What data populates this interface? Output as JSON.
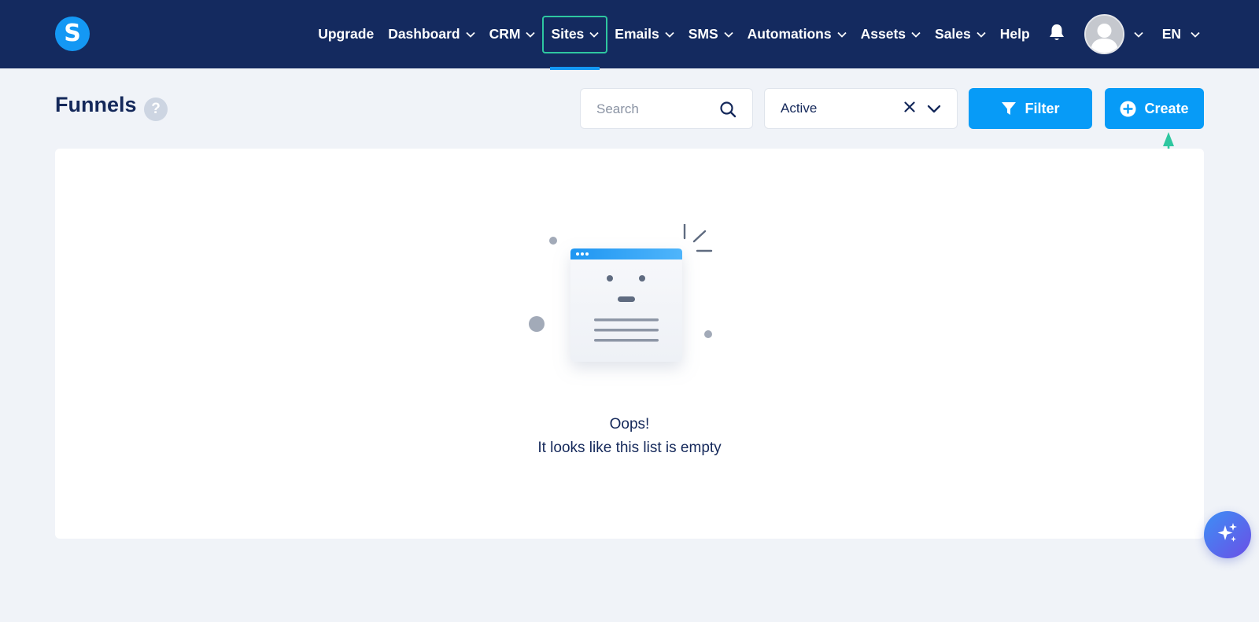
{
  "brand": {
    "logo_letter": "S"
  },
  "nav": {
    "items": [
      {
        "label": "Upgrade",
        "dropdown": false
      },
      {
        "label": "Dashboard",
        "dropdown": true
      },
      {
        "label": "CRM",
        "dropdown": true
      },
      {
        "label": "Sites",
        "dropdown": true,
        "active": true
      },
      {
        "label": "Emails",
        "dropdown": true
      },
      {
        "label": "SMS",
        "dropdown": true
      },
      {
        "label": "Automations",
        "dropdown": true
      },
      {
        "label": "Assets",
        "dropdown": true
      },
      {
        "label": "Sales",
        "dropdown": true
      },
      {
        "label": "Help",
        "dropdown": false
      }
    ],
    "language": "EN"
  },
  "page": {
    "title": "Funnels",
    "help_badge": "?"
  },
  "toolbar": {
    "search_placeholder": "Search",
    "status_value": "Active",
    "filter_label": "Filter",
    "create_label": "Create"
  },
  "empty_state": {
    "title": "Oops!",
    "message": "It looks like this list is empty"
  },
  "icons": {
    "search": "search-icon",
    "clear": "close-icon",
    "dropdown": "chevron-down-icon",
    "filter": "funnel-icon",
    "create": "plus-circle-icon",
    "bell": "bell-icon",
    "fab": "sparkles-icon"
  },
  "colors": {
    "nav_bg": "#142a5f",
    "accent": "#079bf7",
    "active_outline": "#2ec7a0",
    "page_bg": "#f0f3f8",
    "annotation_arrow": "#2ec7a0"
  }
}
